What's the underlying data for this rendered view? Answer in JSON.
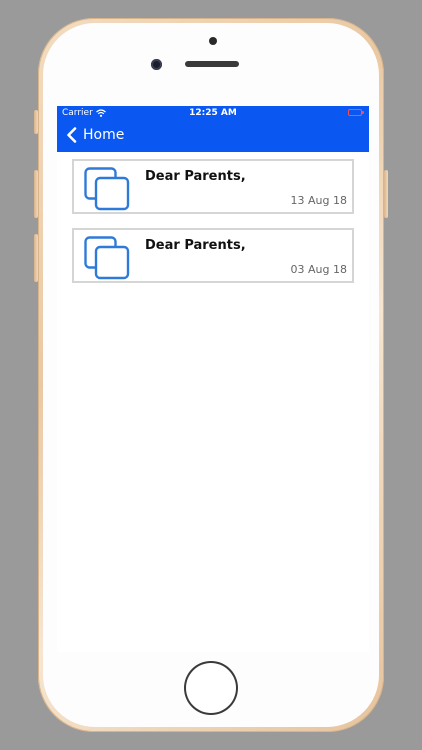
{
  "status_bar": {
    "carrier": "Carrier",
    "time": "12:25 AM"
  },
  "nav": {
    "back_label": "Home"
  },
  "messages": [
    {
      "title": "Dear Parents,",
      "date": "13 Aug 18",
      "icon": "copy-icon"
    },
    {
      "title": "Dear Parents,",
      "date": "03 Aug 18",
      "icon": "copy-icon"
    }
  ],
  "colors": {
    "nav_background": "#0a57f2",
    "icon_color": "#2f7ad8",
    "card_border": "#d5d5d5"
  }
}
